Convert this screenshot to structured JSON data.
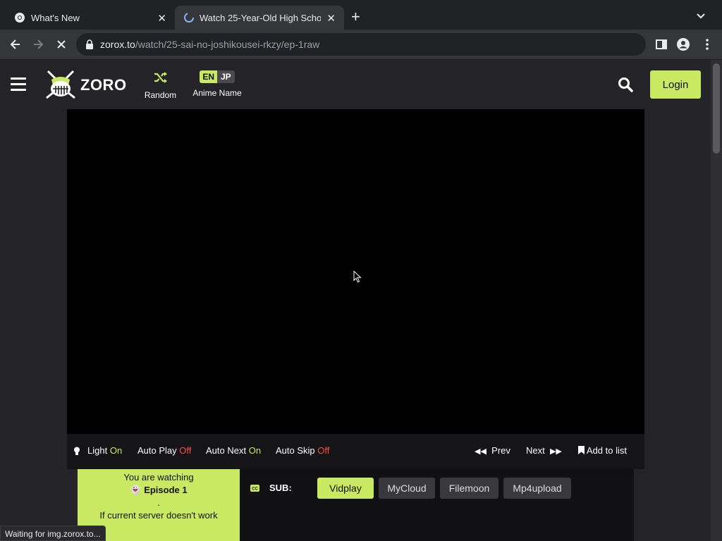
{
  "browser": {
    "tabs": [
      {
        "title": "What's New"
      },
      {
        "title": "Watch 25-Year-Old High Scho"
      }
    ],
    "url_host": "zorox.to",
    "url_path": "/watch/25-sai-no-joshikousei-rkzy/ep-1raw",
    "status_text": "Waiting for img.zorox.to..."
  },
  "header": {
    "logo_text": "ZORO",
    "random_label": "Random",
    "lang_en": "EN",
    "lang_jp": "JP",
    "lang_label": "Anime Name",
    "login_label": "Login"
  },
  "controls": {
    "light_label": "Light",
    "light_value": "On",
    "autoplay_label": "Auto Play",
    "autoplay_value": "Off",
    "autonext_label": "Auto Next",
    "autonext_value": "On",
    "autoskip_label": "Auto Skip",
    "autoskip_value": "Off",
    "prev_label": "Prev",
    "next_label": "Next",
    "addlist_label": "Add to list"
  },
  "servers": {
    "watching_line1": "You are watching",
    "episode": "Episode 1",
    "dot": ".",
    "notice": "If current server doesn't work",
    "sub_label": "SUB:",
    "items": [
      "Vidplay",
      "MyCloud",
      "Filemoon",
      "Mp4upload"
    ],
    "active": "Vidplay"
  },
  "colors": {
    "accent": "#cae962",
    "off": "#ff4a4a",
    "background": "#242428"
  }
}
